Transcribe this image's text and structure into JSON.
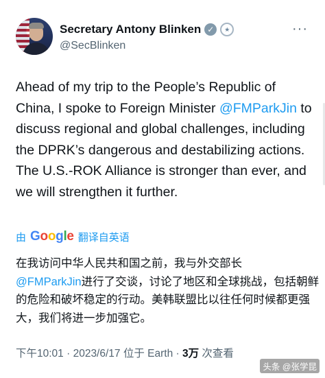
{
  "author": {
    "name": "Secretary Antony Blinken",
    "handle": "@SecBlinken"
  },
  "tweet": {
    "before_mention": "Ahead of my trip to the People’s Republic of China, I spoke to Foreign Minister ",
    "mention": "@FMParkJin",
    "after_mention": " to discuss regional and global challenges, including the DPRK’s dangerous and destabilizing actions. The U.S.-ROK Alliance is stronger than ever, and we will strengthen it further."
  },
  "translation": {
    "prefix": "由",
    "google_letters": [
      "G",
      "o",
      "o",
      "g",
      "l",
      "e"
    ],
    "suffix": "翻译自英语",
    "line1": "在我访问中华人民共和国之前，我与外交部长",
    "mention": "@FMParkJin",
    "line2_rest": "进行了交谈，讨论了地区和全球挑战，包括朝鲜的危险和破坏稳定的行动。美韩联盟比以往任何时候都更强大，我们将进一步加强它。"
  },
  "meta": {
    "time": "下午10:01",
    "sep1": " · ",
    "date": "2023/6/17",
    "location": " 位于 Earth",
    "sep2": " · ",
    "views": "3万",
    "views_label": " 次查看"
  },
  "watermark": "头条 @张学昆",
  "colors": {
    "link": "#1d9bf0",
    "text": "#0f1419",
    "muted": "#536471"
  },
  "icons": {
    "verified": "verified-badge-icon",
    "seal": "government-seal-icon",
    "more": "more-options-icon"
  }
}
